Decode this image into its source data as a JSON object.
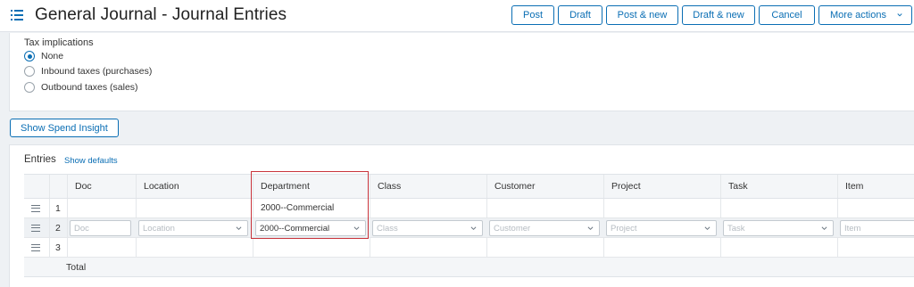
{
  "header": {
    "title": "General Journal - Journal Entries",
    "actions": [
      {
        "label": "Post"
      },
      {
        "label": "Draft"
      },
      {
        "label": "Post & new"
      },
      {
        "label": "Draft & new"
      },
      {
        "label": "Cancel"
      },
      {
        "label": "More actions"
      }
    ]
  },
  "tax": {
    "label": "Tax implications",
    "options": [
      {
        "label": "None",
        "checked": true
      },
      {
        "label": "Inbound taxes (purchases)",
        "checked": false
      },
      {
        "label": "Outbound taxes (sales)",
        "checked": false
      }
    ]
  },
  "spend_insight_label": "Show Spend Insight",
  "entries": {
    "title": "Entries",
    "show_defaults": "Show defaults",
    "columns": [
      "Doc",
      "Location",
      "Department",
      "Class",
      "Customer",
      "Project",
      "Task",
      "Item"
    ],
    "rows": [
      {
        "num": "1",
        "department": "2000--Commercial"
      },
      {
        "num": "2",
        "doc_placeholder": "Doc",
        "location_placeholder": "Location",
        "department": "2000--Commercial",
        "class_placeholder": "Class",
        "customer_placeholder": "Customer",
        "project_placeholder": "Project",
        "task_placeholder": "Task",
        "item_placeholder": "Item"
      },
      {
        "num": "3"
      }
    ],
    "total_label": "Total"
  },
  "colors": {
    "accent": "#0a6eb4",
    "highlight": "#c9343b"
  }
}
